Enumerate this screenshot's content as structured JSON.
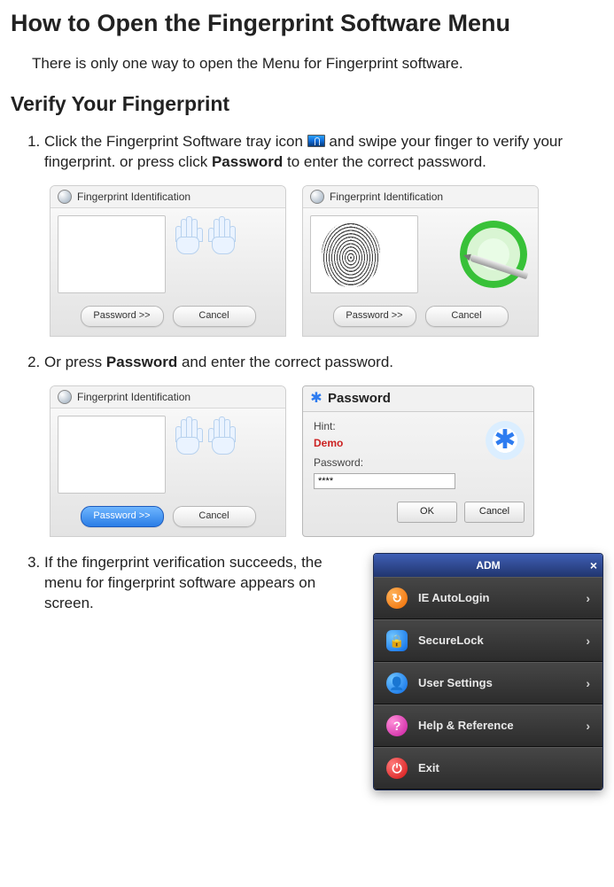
{
  "heading1": "How to Open the Fingerprint Software Menu",
  "intro": "There is only one way to open the Menu for Fingerprint software.",
  "heading2": "Verify Your Fingerprint",
  "steps": {
    "s1a": "Click the Fingerprint Software tray icon ",
    "s1b": " and swipe your finger to verify your fingerprint. or press click ",
    "s1bold": "Password",
    "s1c": " to enter the correct password.",
    "s2a": " Or press ",
    "s2bold": "Password",
    "s2b": " and enter the correct password.",
    "s3": "If the fingerprint verification succeeds, the menu for fingerprint software appears on screen."
  },
  "fp_panel": {
    "title": "Fingerprint Identification",
    "password_btn": "Password >>",
    "cancel_btn": "Cancel"
  },
  "pw_panel": {
    "title": "Password",
    "hint_label": "Hint:",
    "hint_value": "Demo",
    "pw_label": "Password:",
    "pw_value": "****",
    "ok_btn": "OK",
    "cancel_btn": "Cancel"
  },
  "adm": {
    "title": "ADM",
    "items": [
      {
        "icon": "reload-icon",
        "label": "IE AutoLogin",
        "chev": true
      },
      {
        "icon": "lock-icon",
        "label": "SecureLock",
        "chev": true
      },
      {
        "icon": "user-icon",
        "label": "User Settings",
        "chev": true
      },
      {
        "icon": "help-icon",
        "label": "Help & Reference",
        "chev": true
      },
      {
        "icon": "power-icon",
        "label": "Exit",
        "chev": false
      }
    ]
  }
}
